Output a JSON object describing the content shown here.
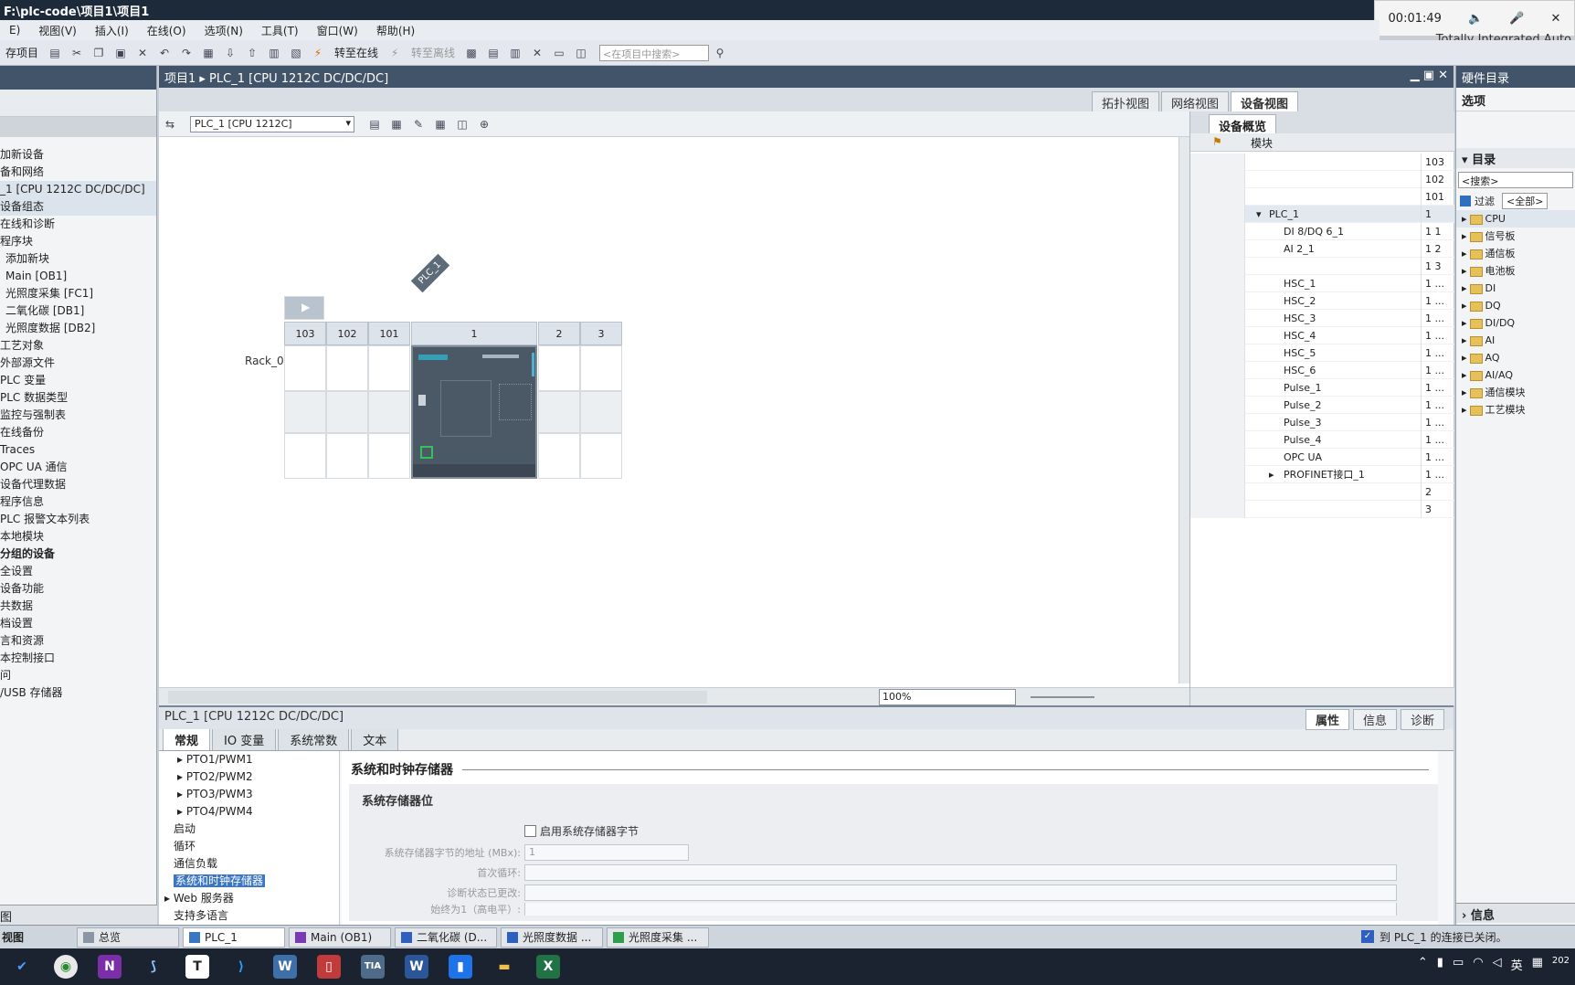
{
  "window": {
    "title": "F:\\plc-code\\项目1\\项目1",
    "product": "Totally Integrated Auto"
  },
  "recorder": {
    "time": "00:01:49"
  },
  "menu": [
    "E)",
    "视图(V)",
    "插入(I)",
    "在线(O)",
    "选项(N)",
    "工具(T)",
    "窗口(W)",
    "帮助(H)"
  ],
  "toolbar": {
    "save_project": "存项目",
    "go_online": "转至在线",
    "go_offline": "转至离线",
    "search_placeholder": "<在项目中搜索>"
  },
  "project_tree": {
    "items": [
      {
        "label": "加新设备"
      },
      {
        "label": "备和网络"
      },
      {
        "label": "_1 [CPU 1212C DC/DC/DC]"
      },
      {
        "label": "设备组态"
      },
      {
        "label": "在线和诊断"
      },
      {
        "label": "程序块"
      },
      {
        "label": "添加新块"
      },
      {
        "label": "Main [OB1]"
      },
      {
        "label": "光照度采集 [FC1]"
      },
      {
        "label": "二氧化碳 [DB1]"
      },
      {
        "label": "光照度数据 [DB2]"
      },
      {
        "label": "工艺对象"
      },
      {
        "label": "外部源文件"
      },
      {
        "label": "PLC 变量"
      },
      {
        "label": "PLC 数据类型"
      },
      {
        "label": "监控与强制表"
      },
      {
        "label": "在线备份"
      },
      {
        "label": "Traces"
      },
      {
        "label": "OPC UA 通信"
      },
      {
        "label": "设备代理数据"
      },
      {
        "label": "程序信息"
      },
      {
        "label": "PLC 报警文本列表"
      },
      {
        "label": "本地模块"
      },
      {
        "label": "分组的设备"
      },
      {
        "label": "全设置"
      },
      {
        "label": "设备功能"
      },
      {
        "label": "共数据"
      },
      {
        "label": "档设置"
      },
      {
        "label": "言和资源"
      },
      {
        "label": "本控制接口"
      },
      {
        "label": "问"
      },
      {
        "label": "/USB 存储器"
      }
    ],
    "bottom": "图"
  },
  "editor": {
    "breadcrumb": "项目1 ▸ PLC_1 [CPU 1212C DC/DC/DC]",
    "view_tabs": [
      "拓扑视图",
      "网络视图",
      "设备视图"
    ],
    "device_select": "PLC_1 [CPU 1212C]",
    "plc_tag": "PLC_1",
    "rack_label": "Rack_0",
    "slots": [
      "103",
      "102",
      "101",
      "1",
      "2",
      "3"
    ],
    "zoom": "100%"
  },
  "overview": {
    "tab": "设备概览",
    "col_module": "模块",
    "rows": [
      {
        "name": "",
        "num": "103"
      },
      {
        "name": "",
        "num": "102"
      },
      {
        "name": "",
        "num": "101"
      },
      {
        "name": "PLC_1",
        "num": "1"
      },
      {
        "name": "DI 8/DQ 6_1",
        "num": "1 1"
      },
      {
        "name": "AI 2_1",
        "num": "1 2"
      },
      {
        "name": "",
        "num": "1 3"
      },
      {
        "name": "HSC_1",
        "num": "1 ..."
      },
      {
        "name": "HSC_2",
        "num": "1 ..."
      },
      {
        "name": "HSC_3",
        "num": "1 ..."
      },
      {
        "name": "HSC_4",
        "num": "1 ..."
      },
      {
        "name": "HSC_5",
        "num": "1 ..."
      },
      {
        "name": "HSC_6",
        "num": "1 ..."
      },
      {
        "name": "Pulse_1",
        "num": "1 ..."
      },
      {
        "name": "Pulse_2",
        "num": "1 ..."
      },
      {
        "name": "Pulse_3",
        "num": "1 ..."
      },
      {
        "name": "Pulse_4",
        "num": "1 ..."
      },
      {
        "name": "OPC UA",
        "num": "1 ..."
      },
      {
        "name": "PROFINET接口_1",
        "num": "1 ..."
      },
      {
        "name": "",
        "num": "2"
      },
      {
        "name": "",
        "num": "3"
      }
    ]
  },
  "catalog": {
    "title": "硬件目录",
    "options": "选项",
    "section": "目录",
    "search": "<搜索>",
    "filter_label": "过滤",
    "filter_value": "<全部>",
    "items": [
      "CPU",
      "信号板",
      "通信板",
      "电池板",
      "DI",
      "DQ",
      "DI/DQ",
      "AI",
      "AQ",
      "AI/AQ",
      "通信模块",
      "工艺模块"
    ],
    "info": "信息"
  },
  "properties": {
    "title": "PLC_1 [CPU 1212C DC/DC/DC]",
    "right_tabs": [
      "属性",
      "信息",
      "诊断"
    ],
    "tabs": [
      "常规",
      "IO 变量",
      "系统常数",
      "文本"
    ],
    "nav": [
      "PTO1/PWM1",
      "PTO2/PWM2",
      "PTO3/PWM3",
      "PTO4/PWM4",
      "启动",
      "循环",
      "通信负载",
      "系统和时钟存储器",
      "Web 服务器",
      "支持多语言"
    ],
    "section_title": "系统和时钟存储器",
    "subsection": "系统存储器位",
    "checkbox_label": "启用系统存储器字节",
    "field_address_label": "系统存储器字节的地址 (MBx):",
    "field_address_value": "1",
    "field_first_cycle": "首次循环:",
    "field_diag_changed": "诊断状态已更改:",
    "field_always1": "始终为1（高电平）:"
  },
  "tia_taskbar": {
    "portal_view": "视图",
    "tabs": [
      "总览",
      "PLC_1",
      "Main (OB1)",
      "二氧化碳 (D...",
      "光照度数据 ...",
      "光照度采集 ..."
    ],
    "status": "到 PLC_1 的连接已关闭。"
  },
  "win_tray": {
    "lang": "英",
    "date": "202"
  }
}
